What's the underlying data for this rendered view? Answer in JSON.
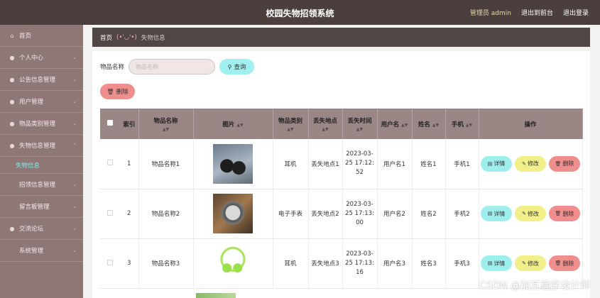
{
  "header": {
    "title": "校园失物招领系统",
    "admin_label": "管理员 admin",
    "back_label": "退出到前台",
    "logout_label": "退出登录"
  },
  "sidebar": {
    "items": [
      {
        "label": "首页",
        "icon": "home-icon"
      },
      {
        "label": "个人中心",
        "icon": "user-icon"
      },
      {
        "label": "公告信息管理",
        "icon": "notice-icon"
      },
      {
        "label": "用户管理",
        "icon": "users-icon"
      },
      {
        "label": "物品类别管理",
        "icon": "category-icon"
      },
      {
        "label": "失物信息管理",
        "icon": "lost-icon"
      },
      {
        "label": "失物信息",
        "sub": true
      },
      {
        "label": "招领信息管理",
        "icon": "found-icon"
      },
      {
        "label": "留言板管理",
        "icon": "message-icon"
      },
      {
        "label": "交流论坛",
        "icon": "forum-icon"
      },
      {
        "label": "系统管理",
        "icon": "settings-icon"
      }
    ]
  },
  "breadcrumb": {
    "home": "首页",
    "emoticon": "(•'◡'•)",
    "current": "失物信息"
  },
  "search": {
    "label": "物品名称",
    "placeholder": "物品名称",
    "button_label": "查询"
  },
  "toolbar": {
    "delete_label": "删除"
  },
  "table": {
    "columns": [
      "索引",
      "物品名称",
      "图片",
      "物品类别",
      "丢失地点",
      "丢失时间",
      "用户名",
      "姓名",
      "手机",
      "操作"
    ],
    "rows": [
      {
        "index": "1",
        "name": "物品名称1",
        "image": "dark-headphones",
        "category": "耳机",
        "place": "丢失地点1",
        "time": [
          "2023-03-",
          "25 17:12:",
          "52"
        ],
        "username": "用户名1",
        "realname": "姓名1",
        "phone": "手机1"
      },
      {
        "index": "2",
        "name": "物品名称2",
        "image": "wrist-watch",
        "category": "电子手表",
        "place": "丢失地点2",
        "time": [
          "2023-03-",
          "25 17:13:",
          "00"
        ],
        "username": "用户名2",
        "realname": "姓名2",
        "phone": "手机2"
      },
      {
        "index": "3",
        "name": "物品名称3",
        "image": "green-headphones",
        "category": "耳机",
        "place": "丢失地点3",
        "time": [
          "2023-03-",
          "25 17:13:",
          "16"
        ],
        "username": "用户名3",
        "realname": "姓名3",
        "phone": "手机3"
      }
    ],
    "actions": {
      "detail": "详情",
      "edit": "修改",
      "delete": "删除"
    }
  },
  "watermark": "CSDN @加瓦程序设计师",
  "colors": {
    "topbar": "#4a3f3d",
    "sidebar": "#8f7775",
    "table_header": "#9a8685",
    "detail_button": "#9feeee",
    "edit_button": "#f0ef89",
    "delete_button": "#f08e8e",
    "active_menu": "#8fe3e8"
  }
}
